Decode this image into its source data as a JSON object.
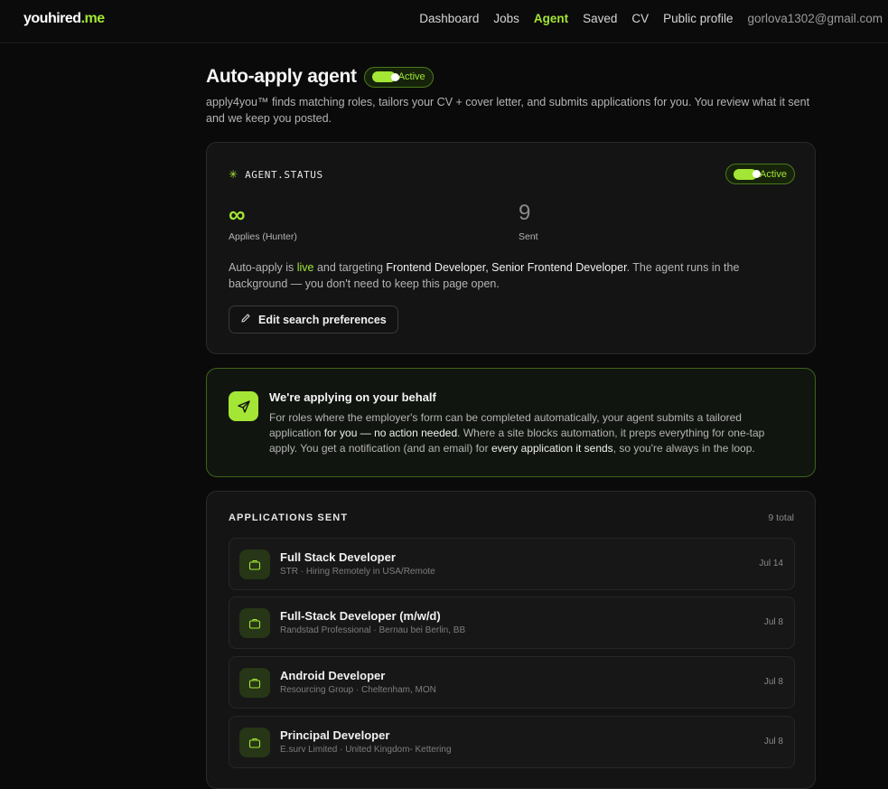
{
  "brand": {
    "name": "youhired",
    "suffix": ".me"
  },
  "nav": {
    "items": [
      "Dashboard",
      "Jobs",
      "Agent",
      "Saved",
      "CV",
      "Public profile"
    ],
    "active": "Agent",
    "email": "gorlova1302@gmail.com"
  },
  "header": {
    "title": "Auto-apply agent",
    "status_label": "Active",
    "subtitle": "apply4you™ finds matching roles, tailors your CV + cover letter, and submits applications for you. You review what it sent and we keep you posted."
  },
  "agent_status": {
    "title": "AGENT.STATUS",
    "toggle_label": "Active",
    "applies_value": "∞",
    "applies_caption": "Applies (Hunter)",
    "sent_value": "9",
    "sent_caption": "Sent",
    "text_prefix": "Auto-apply is ",
    "text_live": "live",
    "text_mid": " and targeting ",
    "text_roles": "Frontend Developer, Senior Frontend Developer",
    "text_suffix": ". The agent runs in the background — you don't need to keep this page open.",
    "edit_button": "Edit search preferences"
  },
  "behalf": {
    "title": "We're applying on your behalf",
    "p1": "For roles where the employer's form can be completed automatically, your agent submits a tailored application ",
    "p1_hl": "for you — no action needed",
    "p2": ". Where a site blocks automation, it preps everything for one-tap apply. You get a notification (and an email) for ",
    "p2_hl": "every application it sends",
    "p3": ", so you're always in the loop."
  },
  "applications": {
    "title": "APPLICATIONS SENT",
    "total": "9 total",
    "items": [
      {
        "title": "Full Stack Developer",
        "subtitle": "STR · Hiring Remotely in USA/Remote",
        "date": "Jul 14"
      },
      {
        "title": "Full-Stack Developer (m/w/d)",
        "subtitle": "Randstad Professional · Bernau bei Berlin, BB",
        "date": "Jul 8"
      },
      {
        "title": "Android Developer",
        "subtitle": "Resourcing Group · Cheltenham, MON",
        "date": "Jul 8"
      },
      {
        "title": "Principal Developer",
        "subtitle": "E.surv Limited · United Kingdom- Kettering",
        "date": "Jul 8"
      }
    ]
  },
  "colors": {
    "accent": "#a3e635",
    "background": "#0a0a0a",
    "card": "#141414"
  },
  "icons": {
    "status": "sparkle-icon",
    "edit": "pencil-icon",
    "behalf": "send-icon",
    "app": "briefcase-icon"
  }
}
